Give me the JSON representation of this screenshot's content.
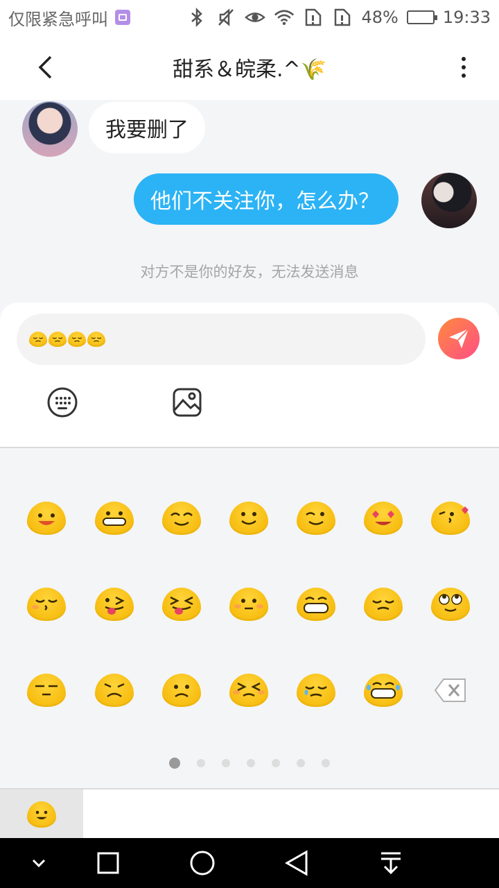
{
  "status_bar": {
    "carrier": "仅限紧急呼叫",
    "battery_percent": "48%",
    "battery_level": 0.48,
    "time": "19:33",
    "icons": [
      "bluetooth-icon",
      "mute-icon",
      "eye-icon",
      "wifi-icon",
      "sim-alert-icon",
      "sim-alert-icon",
      "battery-icon"
    ]
  },
  "header": {
    "title": "甜系＆皖柔.^",
    "title_decoration": "🌾"
  },
  "messages": [
    {
      "side": "left",
      "text": "我要删了",
      "avatar": "anime-girl-avatar"
    },
    {
      "side": "right",
      "text": "他们不关注你，怎么办？",
      "avatar": "masked-boy-avatar"
    }
  ],
  "system_notice": "对方不是你的好友，无法发送消息",
  "composer": {
    "input_emoji_count": 4,
    "input_emoji": "disappointed-face"
  },
  "emoji_grid": [
    [
      "smiling-face",
      "grinning-face",
      "smiling-eyes-face",
      "slight-smile-face",
      "winking-face",
      "heart-eyes-face",
      "kissing-heart-face"
    ],
    [
      "kissing-face",
      "tongue-wink-face",
      "squinting-tongue-face",
      "neutral-blush-face",
      "big-grin-face",
      "disappointed-face",
      "rolling-eyes-face"
    ],
    [
      "unamused-face",
      "worried-face",
      "sad-face",
      "persevering-face",
      "crying-face",
      "laugh-tears-face",
      "delete-key"
    ]
  ],
  "pager": {
    "pages": 7,
    "current_index": 0
  },
  "colors": {
    "accent_blue": "#2bb3f5",
    "send_gradient_start": "#ff8a3d",
    "send_gradient_end": "#ff4e86",
    "emoji_yellow": "#ffcf2e"
  }
}
